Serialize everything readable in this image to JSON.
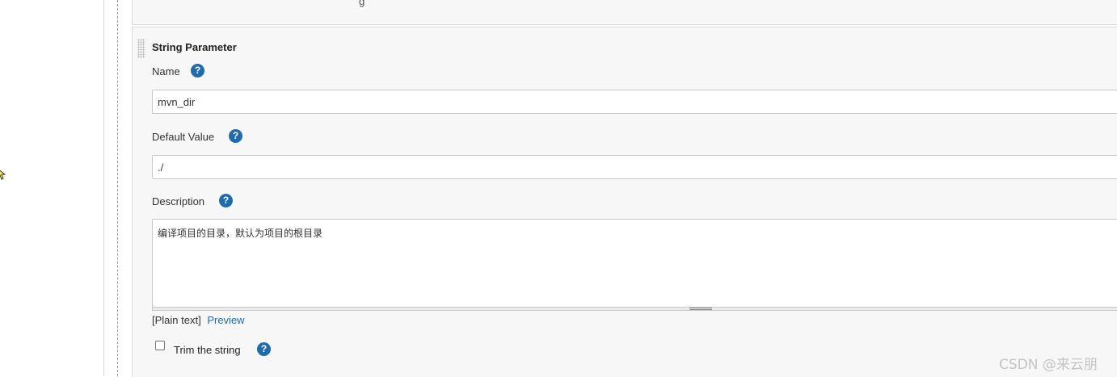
{
  "param": {
    "title": "String Parameter",
    "name_label": "Name",
    "name_value": "mvn_dir",
    "default_label": "Default Value",
    "default_value": "./",
    "description_label": "Description",
    "description_value": "编译项目的目录，默认为项目的根目录",
    "format_plain": "[Plain text]",
    "format_preview": "Preview",
    "trim_label": "Trim the string",
    "trim_checked": false,
    "help_symbol": "?"
  },
  "icons": [
    "help-icon",
    "drag-handle-icon",
    "cursor-icon"
  ],
  "colors": {
    "link": "#1f6bb0",
    "help_icon": "#1f6bb0",
    "panel_bg": "#f7f7f7"
  },
  "watermark": "CSDN @来云朋"
}
